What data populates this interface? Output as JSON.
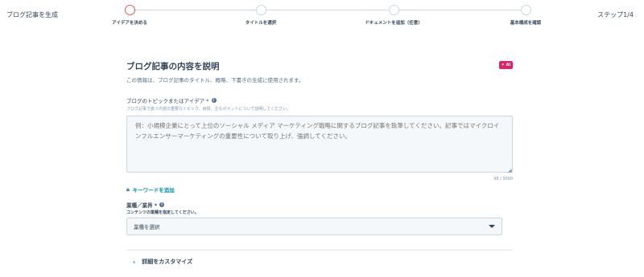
{
  "header": {
    "app_title": "ブログ記事を生成",
    "step_counter": "ステップ1/4"
  },
  "stepper": {
    "steps": [
      {
        "label": "アイデアを決める",
        "active": true
      },
      {
        "label": "タイトルを選択",
        "active": false
      },
      {
        "label": "ドキュメントを追加（任意）",
        "active": false
      },
      {
        "label": "基本構成を確認",
        "active": false
      }
    ]
  },
  "form": {
    "title": "ブログ記事の内容を説明",
    "ai_badge": "✦ AI",
    "subtitle": "この情報は、ブログ記事のタイトル、概略、下書きの生成に使用されます。",
    "topic": {
      "label": "ブログのトピックまたはアイデア *",
      "help": "ブログ記事で扱う内容の重要なトピック、目標、主なポイントについて説明してください。",
      "placeholder": "例：小規模企業にとって上位のソーシャル メディア マーケティング戦略に関するブログ記事を執筆してください。記事ではマイクロインフルエンサーマーケティングの重要性について取り上げ、強調してください。",
      "value": "",
      "char_count": "98 / 3000"
    },
    "add_keyword_label": "キーワードを追加",
    "industry": {
      "label": "業種／業界 *",
      "help": "コンテンツの業種を指定してください。",
      "selected": "業種を選択"
    },
    "customize_label": "詳細をカスタマイズ"
  },
  "colors": {
    "accent": "#f2545b",
    "link": "#0091ae",
    "ai_badge": "#e0226a"
  }
}
